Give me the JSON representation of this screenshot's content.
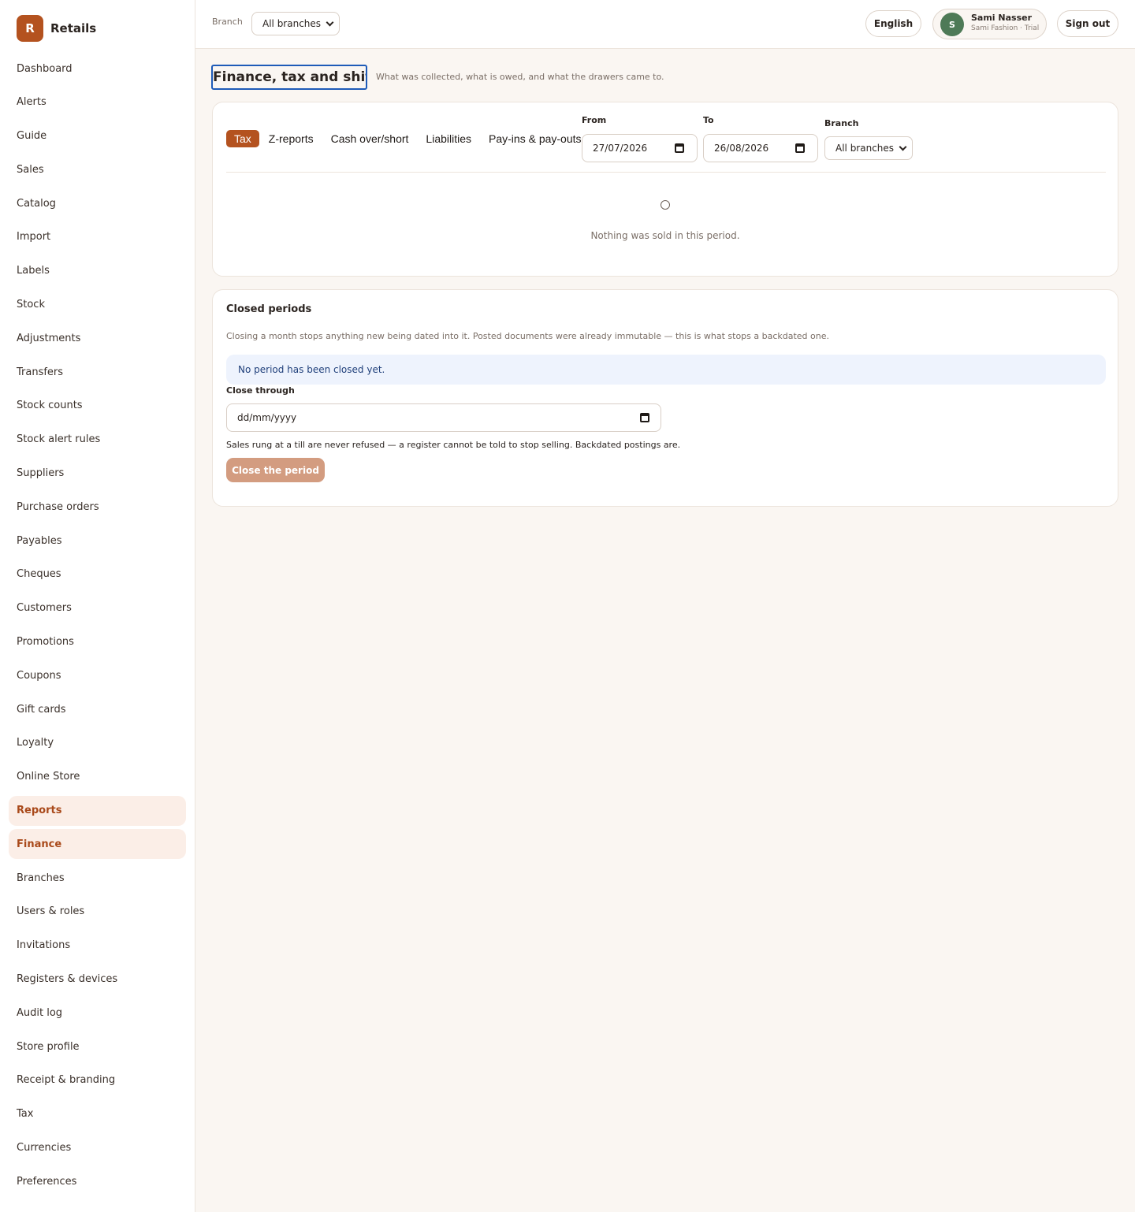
{
  "brand": {
    "logo_letter": "R",
    "name": "Retails"
  },
  "sidebar": {
    "items": [
      {
        "label": "Dashboard"
      },
      {
        "label": "Alerts"
      },
      {
        "label": "Guide"
      },
      {
        "label": "Sales"
      },
      {
        "label": "Catalog"
      },
      {
        "label": "Import"
      },
      {
        "label": "Labels"
      },
      {
        "label": "Stock"
      },
      {
        "label": "Adjustments"
      },
      {
        "label": "Transfers"
      },
      {
        "label": "Stock counts"
      },
      {
        "label": "Stock alert rules"
      },
      {
        "label": "Suppliers"
      },
      {
        "label": "Purchase orders"
      },
      {
        "label": "Payables"
      },
      {
        "label": "Cheques"
      },
      {
        "label": "Customers"
      },
      {
        "label": "Promotions"
      },
      {
        "label": "Coupons"
      },
      {
        "label": "Gift cards"
      },
      {
        "label": "Loyalty"
      },
      {
        "label": "Online Store"
      },
      {
        "label": "Reports"
      },
      {
        "label": "Finance"
      },
      {
        "label": "Branches"
      },
      {
        "label": "Users & roles"
      },
      {
        "label": "Invitations"
      },
      {
        "label": "Registers & devices"
      },
      {
        "label": "Audit log"
      },
      {
        "label": "Store profile"
      },
      {
        "label": "Receipt & branding"
      },
      {
        "label": "Tax"
      },
      {
        "label": "Currencies"
      },
      {
        "label": "Preferences"
      }
    ],
    "highlighted": [
      "Reports",
      "Finance"
    ]
  },
  "topbar": {
    "branch_label": "Branch",
    "branch_value": "All branches",
    "language_button": "English",
    "user": {
      "initial": "S",
      "name": "Sami Nasser",
      "subtitle": "Sami Fashion · Trial"
    },
    "sign_out": "Sign out"
  },
  "page": {
    "title": "Finance, tax and shifts",
    "subtitle": "What was collected, what is owed, and what the drawers came to."
  },
  "report_card": {
    "tabs": [
      {
        "label": "Tax"
      },
      {
        "label": "Z-reports"
      },
      {
        "label": "Cash over/short"
      },
      {
        "label": "Liabilities"
      },
      {
        "label": "Pay-ins & pay-outs"
      }
    ],
    "active_tab": "Tax",
    "from_label": "From",
    "from_value": "27/07/2026",
    "to_label": "To",
    "to_value": "26/08/2026",
    "branch_label": "Branch",
    "branch_value": "All branches",
    "empty_message": "Nothing was sold in this period."
  },
  "closed_periods": {
    "title": "Closed periods",
    "description": "Closing a month stops anything new being dated into it. Posted documents were already immutable — this is what stops a backdated one.",
    "notice": "No period has been closed yet.",
    "close_through_label": "Close through",
    "close_through_placeholder": "dd/mm/yyyy",
    "help_text": "Sales rung at a till are never refused — a register cannot be told to stop selling. Backdated postings are.",
    "button_label": "Close the period"
  },
  "colors": {
    "accent": "#b4521f",
    "active_nav_bg": "#fbeee7",
    "notice_bg": "#eef3fd",
    "avatar": "#4e7a57",
    "page_bg": "#faf6f2"
  }
}
